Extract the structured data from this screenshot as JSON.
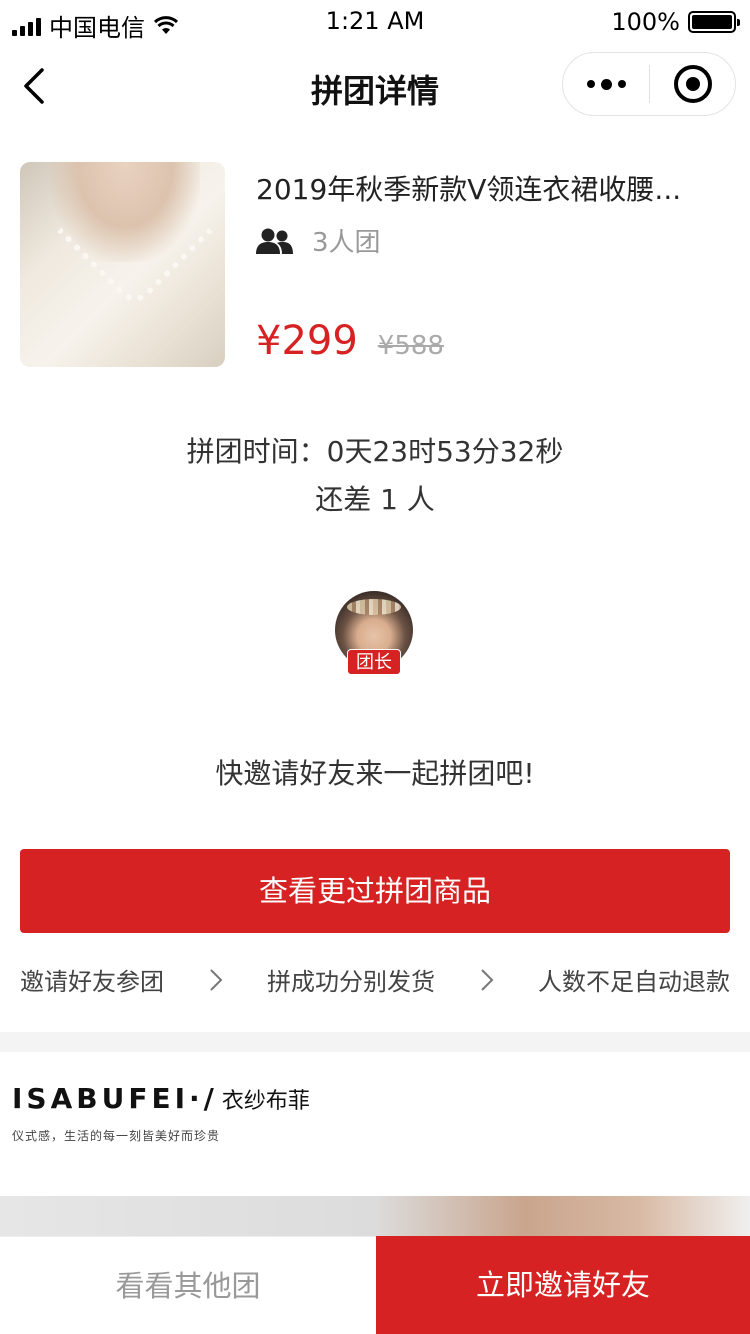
{
  "status_bar": {
    "carrier": "中国电信",
    "time": "1:21 AM",
    "battery": "100%"
  },
  "nav": {
    "title": "拼团详情"
  },
  "product": {
    "title": "2019年秋季新款V领连衣裙收腰...",
    "group_size": "3人团",
    "price": "¥299",
    "original_price": "¥588"
  },
  "group_info": {
    "countdown": "拼团时间：0天23时53分32秒",
    "remaining": "还差 1 人",
    "leader_badge": "团长",
    "invite_text": "快邀请好友来一起拼团吧!"
  },
  "actions": {
    "view_more": "查看更过拼团商品"
  },
  "steps": [
    "邀请好友参团",
    "拼成功分别发货",
    "人数不足自动退款"
  ],
  "brand": {
    "latin": "ISABUFEI·/",
    "cn": "衣纱布菲",
    "slogan": "仪式感，生活的每一刻皆美好而珍贵"
  },
  "bottom_bar": {
    "other_groups": "看看其他团",
    "invite_friends": "立即邀请好友"
  },
  "colors": {
    "accent": "#d62222"
  }
}
